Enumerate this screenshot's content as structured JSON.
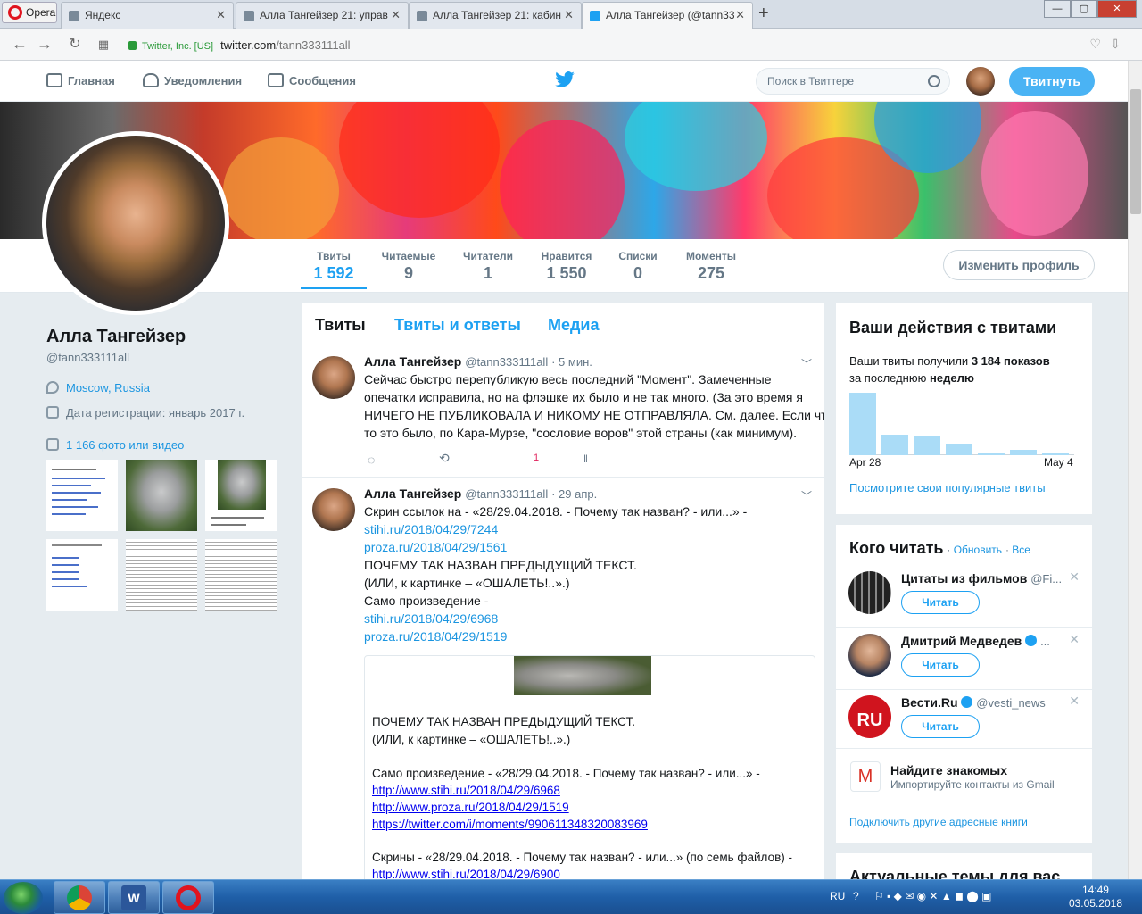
{
  "browser": {
    "menu_label": "Opera",
    "tabs": [
      {
        "title": "Яндекс"
      },
      {
        "title": "Алла Тангейзер 21: управ"
      },
      {
        "title": "Алла Тангейзер 21: кабин"
      },
      {
        "title": "Алла Тангейзер (@tann33"
      }
    ],
    "cert": "Twitter, Inc. [US]",
    "url_host": "twitter.com",
    "url_path": "/tann333111all",
    "new_tab": "+"
  },
  "nav": {
    "home": "Главная",
    "notifications": "Уведомления",
    "messages": "Сообщения",
    "search_placeholder": "Поиск в Твиттере",
    "tweet_button": "Твитнуть"
  },
  "profile_stats": [
    {
      "label": "Твиты",
      "value": "1 592"
    },
    {
      "label": "Читаемые",
      "value": "9"
    },
    {
      "label": "Читатели",
      "value": "1"
    },
    {
      "label": "Нравится",
      "value": "1 550"
    },
    {
      "label": "Списки",
      "value": "0"
    },
    {
      "label": "Моменты",
      "value": "275"
    }
  ],
  "edit_profile": "Изменить профиль",
  "profile": {
    "name": "Алла Тангейзер",
    "handle": "@tann333111all",
    "location": "Moscow, Russia",
    "joined": "Дата регистрации: январь 2017 г.",
    "media_link": "1 166 фото или видео"
  },
  "timeline_tabs": {
    "tweets": "Твиты",
    "replies": "Твиты и ответы",
    "media": "Медиа"
  },
  "tweets": [
    {
      "name": "Алла Тангейзер",
      "handle": "@tann333111all",
      "time": "· 5 мин.",
      "lines": [
        "Сейчас быстро перепубликую весь последний \"Момент\". Замеченные",
        "опечатки исправила, но на флэшке их было и не так много. (За это время я",
        "НИЧЕГО НЕ ПУБЛИКОВАЛА И НИКОМУ НЕ ОТПРАВЛЯЛА. См. далее. Если что,",
        "то это было, по Кара-Мурзе, \"сословие воров\" этой страны (как минимум)."
      ],
      "likes": "1"
    },
    {
      "name": "Алла Тангейзер",
      "handle": "@tann333111all",
      "time": "· 29 апр.",
      "line1": "Скрин ссылок на - «28/29.04.2018. - Почему так назван? - или...» -",
      "link1": "stihi.ru/2018/04/29/7244",
      "link2": "proza.ru/2018/04/29/1561",
      "line2": "ПОЧЕМУ ТАК НАЗВАН ПРЕДЫДУЩИЙ ТЕКСТ.",
      "line3": "(ИЛИ, к картинке – «ОШАЛЕТЬ!..».)",
      "line4": "Само произведение -",
      "link3": "stihi.ru/2018/04/29/6968",
      "link4": "proza.ru/2018/04/29/1519"
    }
  ],
  "embed": {
    "t1": "ПОЧЕМУ ТАК НАЗВАН ПРЕДЫДУЩИЙ ТЕКСТ.",
    "t2": "(ИЛИ, к картинке – «ОШАЛЕТЬ!..».)",
    "t3": "Само произведение - «28/29.04.2018.  - Почему так назван? - или...» -",
    "l1": "http://www.stihi.ru/2018/04/29/6968",
    "l2": "http://www.proza.ru/2018/04/29/1519",
    "l3": "https://twitter.com/i/moments/990611348320083969",
    "t4": "Скрины - «28/29.04.2018.  - Почему так назван? - или...» (по семь файлов) -",
    "l4": "http://www.stihi.ru/2018/04/29/6900"
  },
  "activity": {
    "title": "Ваши действия с твитами",
    "text_pre": "Ваши твиты получили",
    "impressions": "3 184 показов",
    "text_mid": "за последнюю",
    "period": "неделю",
    "date_start": "Apr 28",
    "date_end": "May 4",
    "daily_relative": [
      1.0,
      0.33,
      0.31,
      0.19,
      0.04,
      0.08,
      0.0
    ],
    "link": "Посмотрите свои популярные твиты"
  },
  "who_to_follow": {
    "title": "Кого читать",
    "refresh": "Обновить",
    "all": "Все",
    "items": [
      {
        "name": "Цитаты из фильмов",
        "handle": "@Fi..."
      },
      {
        "name": "Дмитрий Медведев",
        "handle": "..."
      },
      {
        "name": "Вести.Ru",
        "handle": "@vesti_news"
      }
    ],
    "follow_label": "Читать",
    "find_title": "Найдите знакомых",
    "find_sub": "Импортируйте контакты из Gmail",
    "connect": "Подключить другие адресные книги"
  },
  "trends_title": "Актуальные темы для вас",
  "taskbar": {
    "lang": "RU",
    "time": "14:49",
    "date": "03.05.2018"
  },
  "colors": {
    "accent": "#1da1f2",
    "tweet_btn": "#4ab3f4",
    "like": "#e0245e"
  }
}
